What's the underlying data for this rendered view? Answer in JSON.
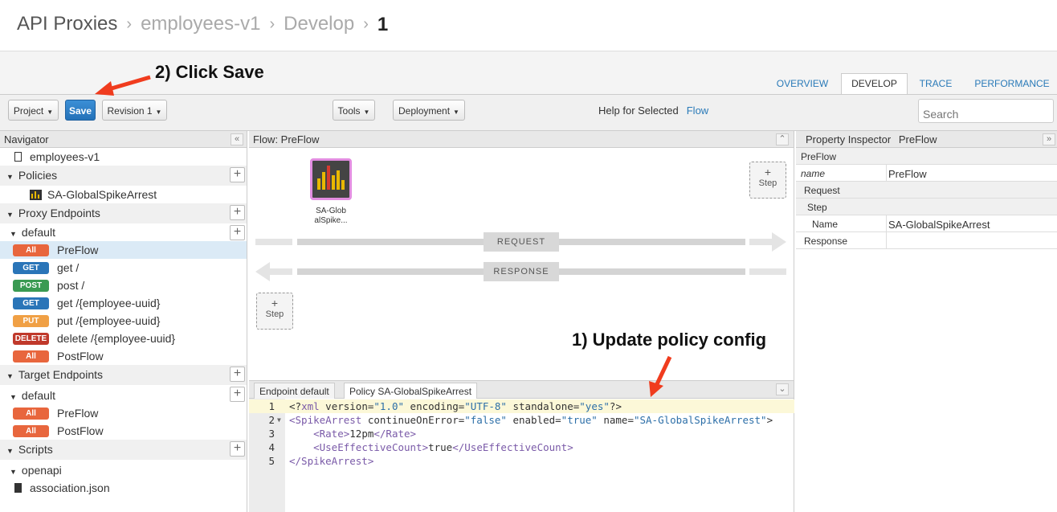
{
  "breadcrumb": [
    "API Proxies",
    "employees-v1",
    "Develop",
    "1"
  ],
  "tabs": [
    {
      "label": "OVERVIEW",
      "active": false
    },
    {
      "label": "DEVELOP",
      "active": true
    },
    {
      "label": "TRACE",
      "active": false
    },
    {
      "label": "PERFORMANCE",
      "active": false
    }
  ],
  "toolbar": {
    "project": "Project",
    "save": "Save",
    "revision": "Revision 1",
    "tools": "Tools",
    "deployment": "Deployment",
    "help_label": "Help for Selected",
    "help_link": "Flow",
    "search_placeholder": "Search"
  },
  "navigator": {
    "title": "Navigator",
    "proxy_name": "employees-v1",
    "policies_label": "Policies",
    "policy_item": "SA-GlobalSpikeArrest",
    "proxy_endpoints_label": "Proxy Endpoints",
    "proxy_default": "default",
    "proxy_flows": [
      {
        "verb": "All",
        "color": "#e8663d",
        "label": "PreFlow",
        "selected": true
      },
      {
        "verb": "GET",
        "color": "#2a75b8",
        "label": "get /"
      },
      {
        "verb": "POST",
        "color": "#3a9a52",
        "label": "post /"
      },
      {
        "verb": "GET",
        "color": "#2a75b8",
        "label": "get /{employee-uuid}"
      },
      {
        "verb": "PUT",
        "color": "#f0a045",
        "label": "put /{employee-uuid}"
      },
      {
        "verb": "DELETE",
        "color": "#c0392b",
        "label": "delete /{employee-uuid}"
      },
      {
        "verb": "All",
        "color": "#e8663d",
        "label": "PostFlow"
      }
    ],
    "target_endpoints_label": "Target Endpoints",
    "target_default": "default",
    "target_flows": [
      {
        "verb": "All",
        "color": "#e8663d",
        "label": "PreFlow"
      },
      {
        "verb": "All",
        "color": "#e8663d",
        "label": "PostFlow"
      }
    ],
    "scripts_label": "Scripts",
    "scripts_folder": "openapi",
    "scripts_file": "association.json"
  },
  "flow": {
    "title": "Flow: PreFlow",
    "policy_label_line1": "SA-Glob",
    "policy_label_line2": "alSpike...",
    "step_label": "Step",
    "request_label": "REQUEST",
    "response_label": "RESPONSE"
  },
  "editor": {
    "tabs": [
      "Endpoint default",
      "Policy SA-GlobalSpikeArrest"
    ],
    "line_numbers": [
      "1",
      "2",
      "3",
      "4",
      "5"
    ]
  },
  "inspector": {
    "title": "Property Inspector",
    "subject": "PreFlow",
    "section": "PreFlow",
    "name_key": "name",
    "name_value": "PreFlow",
    "request_label": "Request",
    "step_label": "Step",
    "step_name_key": "Name",
    "step_name_value": "SA-GlobalSpikeArrest",
    "response_label": "Response"
  },
  "annotations": {
    "save_note": "2) Click Save",
    "config_note": "1) Update policy config"
  }
}
